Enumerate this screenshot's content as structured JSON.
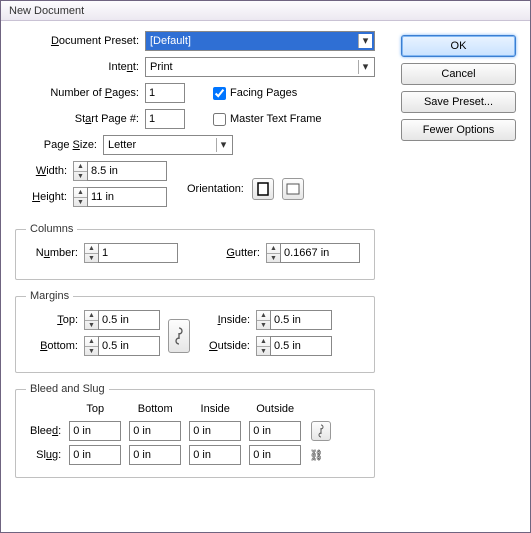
{
  "title": "New Document",
  "buttons": {
    "ok": "OK",
    "cancel": "Cancel",
    "save_preset": "Save Preset...",
    "fewer_options": "Fewer Options"
  },
  "preset": {
    "label": "Document Preset:",
    "value": "[Default]"
  },
  "intent": {
    "label": "Intent:",
    "value": "Print"
  },
  "pages": {
    "num_label": "Number of Pages:",
    "num_value": "1",
    "start_label": "Start Page #:",
    "start_value": "1",
    "facing": "Facing Pages",
    "master": "Master Text Frame",
    "facing_checked": true,
    "master_checked": false
  },
  "pagesize": {
    "label": "Page Size:",
    "value": "Letter",
    "width_label": "Width:",
    "width_value": "8.5 in",
    "height_label": "Height:",
    "height_value": "11 in",
    "orientation_label": "Orientation:"
  },
  "columns": {
    "legend": "Columns",
    "number_label": "Number:",
    "number_value": "1",
    "gutter_label": "Gutter:",
    "gutter_value": "0.1667 in"
  },
  "margins": {
    "legend": "Margins",
    "top_label": "Top:",
    "top_value": "0.5 in",
    "bottom_label": "Bottom:",
    "bottom_value": "0.5 in",
    "inside_label": "Inside:",
    "inside_value": "0.5 in",
    "outside_label": "Outside:",
    "outside_value": "0.5 in"
  },
  "bleed": {
    "legend": "Bleed and Slug",
    "cols": {
      "top": "Top",
      "bottom": "Bottom",
      "inside": "Inside",
      "outside": "Outside"
    },
    "bleed_label": "Bleed:",
    "slug_label": "Slug:",
    "bleed": {
      "top": "0 in",
      "bottom": "0 in",
      "inside": "0 in",
      "outside": "0 in"
    },
    "slug": {
      "top": "0 in",
      "bottom": "0 in",
      "inside": "0 in",
      "outside": "0 in"
    }
  }
}
